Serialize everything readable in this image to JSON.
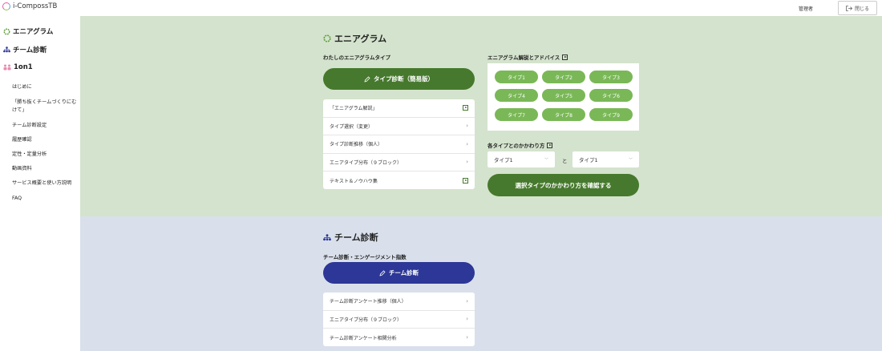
{
  "header": {
    "logo_text": "i-CompossTB",
    "admin_label": "管理者",
    "close_label": "閉じる"
  },
  "sidebar": {
    "main_items": [
      {
        "label": "エニアグラム",
        "icon": "ring-icon"
      },
      {
        "label": "チーム診断",
        "icon": "org-icon"
      },
      {
        "label": "1on1",
        "icon": "people-icon"
      }
    ],
    "sub_items": [
      "はじめに",
      "「勝ち抜くチームづくりにむけて」",
      "チーム診断設定",
      "履歴確認",
      "定性・定量分析",
      "動画資料",
      "サービス概要と使い方説明",
      "FAQ"
    ]
  },
  "enneagram": {
    "title": "エニアグラム",
    "my_type_label": "わたしのエニアグラムタイプ",
    "diagnose_button": "タイプ診断（簡易版）",
    "menu": [
      {
        "label": "「エニアグラム解説」",
        "icon": "external-link-icon"
      },
      {
        "label": "タイプ選択（変更）",
        "icon": "chevron-right-icon"
      },
      {
        "label": "タイプ診断推移（個人）",
        "icon": "chevron-right-icon"
      },
      {
        "label": "エニアタイプ分布（９ブロック）",
        "icon": "chevron-right-icon"
      },
      {
        "label": "テキスト＆ノウハウ集",
        "icon": "external-link-icon"
      }
    ],
    "advice_label": "エニアグラム解説とアドバイス",
    "types": [
      "タイプ1",
      "タイプ2",
      "タイプ3",
      "タイプ4",
      "タイプ5",
      "タイプ6",
      "タイプ7",
      "タイプ8",
      "タイプ9"
    ],
    "relation_label": "各タイプとのかかわり方",
    "select_a": "タイプ1",
    "select_connector": "と",
    "select_b": "タイプ1",
    "confirm_button": "選択タイプのかかわり方を確認する"
  },
  "team": {
    "title": "チーム診断",
    "engagement_label": "チーム診断・エンゲージメント指数",
    "diagnose_button": "チーム診断",
    "menu": [
      {
        "label": "チーム診断アンケート推移（個人）"
      },
      {
        "label": "エニアタイプ分布（９ブロック）"
      },
      {
        "label": "チーム診断アンケート相関分析"
      }
    ]
  },
  "colors": {
    "green_panel": "#d4e3cd",
    "blue_panel": "#d9e0eb",
    "green_button": "#46792d",
    "blue_button": "#2c3797",
    "type_button": "#7ab857"
  }
}
